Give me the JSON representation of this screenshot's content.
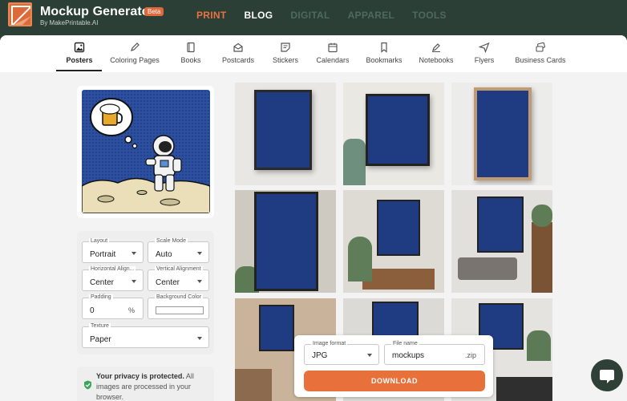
{
  "brand": {
    "title": "Mockup Generator",
    "badge": "Beta",
    "subtitle": "By MakePrintable.AI"
  },
  "topnav": [
    {
      "label": "PRINT",
      "state": "active"
    },
    {
      "label": "BLOG",
      "state": "white"
    },
    {
      "label": "DIGITAL",
      "state": "dim"
    },
    {
      "label": "APPAREL",
      "state": "dim"
    },
    {
      "label": "TOOLS",
      "state": "dim"
    }
  ],
  "tabs": [
    {
      "label": "Posters",
      "icon": "image-icon"
    },
    {
      "label": "Coloring Pages",
      "icon": "pencil-icon"
    },
    {
      "label": "Books",
      "icon": "book-icon"
    },
    {
      "label": "Postcards",
      "icon": "mail-icon"
    },
    {
      "label": "Stickers",
      "icon": "sticker-icon"
    },
    {
      "label": "Calendars",
      "icon": "calendar-icon"
    },
    {
      "label": "Bookmarks",
      "icon": "bookmark-icon"
    },
    {
      "label": "Notebooks",
      "icon": "notebook-pen-icon"
    },
    {
      "label": "Flyers",
      "icon": "send-icon"
    },
    {
      "label": "Business Cards",
      "icon": "cards-icon"
    }
  ],
  "settings": {
    "layout": {
      "label": "Layout",
      "value": "Portrait"
    },
    "scale_mode": {
      "label": "Scale Mode",
      "value": "Auto"
    },
    "h_align": {
      "label": "Horizontal Align...",
      "value": "Center"
    },
    "v_align": {
      "label": "Vertical Alignment",
      "value": "Center"
    },
    "padding": {
      "label": "Padding",
      "value": "0",
      "unit": "%"
    },
    "bg_color": {
      "label": "Background Color",
      "value": "#ffffff"
    },
    "texture": {
      "label": "Texture",
      "value": "Paper"
    }
  },
  "privacy": {
    "bold": "Your privacy is protected.",
    "rest": " All images are processed in your browser."
  },
  "export": {
    "format_label": "Image format",
    "format_value": "JPG",
    "filename_label": "File name",
    "filename_value": "mockups",
    "filename_ext": ".zip",
    "download_label": "DOWNLOAD"
  },
  "colors": {
    "accent": "#e8703b",
    "header": "#2b3f37",
    "poster_blue": "#2b4f9e"
  }
}
